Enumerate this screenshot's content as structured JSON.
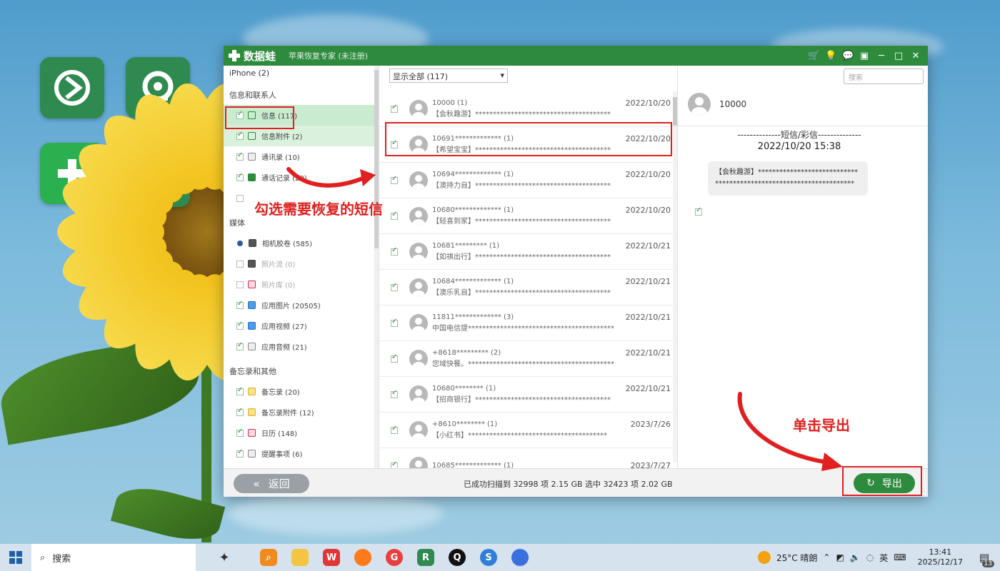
{
  "window": {
    "brand": "数据蛙",
    "subtitle": "苹果恢复专家 (未注册)",
    "controls": [
      "🛒",
      "💡",
      "💬",
      "▣",
      "─",
      "□",
      "✕"
    ]
  },
  "left_panel": {
    "device": "iPhone (2)",
    "sections": [
      {
        "title": "信息和联系人",
        "items": [
          {
            "label": "信息 (117)",
            "checked": true
          },
          {
            "label": "信息附件 (2)",
            "checked": true
          },
          {
            "label": "通讯录 (10)",
            "checked": true
          },
          {
            "label": "通话记录 (20)",
            "checked": true
          },
          {
            "label": "",
            "checked": false
          }
        ]
      },
      {
        "title": "媒体",
        "items": [
          {
            "label": "相机胶卷 (585)"
          },
          {
            "label": "照片流 (0)"
          },
          {
            "label": "照片库 (0)"
          },
          {
            "label": "应用图片 (20505)"
          },
          {
            "label": "应用视频 (27)"
          },
          {
            "label": "应用音频 (21)"
          }
        ]
      },
      {
        "title": "备忘录和其他",
        "items": [
          {
            "label": "备忘录 (20)"
          },
          {
            "label": "备忘录附件 (12)"
          },
          {
            "label": "日历 (148)"
          },
          {
            "label": "提醒事项 (6)"
          }
        ]
      }
    ]
  },
  "filter": {
    "value": "显示全部 (117)",
    "arrow": "▾"
  },
  "messages": [
    {
      "name": "10000 (1)",
      "date": "2022/10/20",
      "preview": "【会秋趣游】**************************************"
    },
    {
      "name": "10691************* (1)",
      "date": "2022/10/20",
      "preview": "【希望宝宝】**************************************"
    },
    {
      "name": "10694************* (1)",
      "date": "2022/10/20",
      "preview": "【澳持力自】**************************************"
    },
    {
      "name": "10680************* (1)",
      "date": "2022/10/20",
      "preview": "【轻喜到家】**************************************"
    },
    {
      "name": "10681********* (1)",
      "date": "2022/10/21",
      "preview": "【如祺出行】**************************************"
    },
    {
      "name": "10684************* (1)",
      "date": "2022/10/21",
      "preview": "【澳乐乳自】**************************************"
    },
    {
      "name": "11811************* (3)",
      "date": "2022/10/21",
      "preview": "中国电信提*****************************************"
    },
    {
      "name": "+8618********* (2)",
      "date": "2022/10/21",
      "preview": "您域快餐。*****************************************"
    },
    {
      "name": "10680******** (1)",
      "date": "2022/10/21",
      "preview": "【招商银行】**************************************"
    },
    {
      "name": "+8610******** (1)",
      "date": "2023/7/26",
      "preview": "【小红书】***************************************"
    },
    {
      "name": "10685************* (1)",
      "date": "2023/7/27",
      "preview": ""
    }
  ],
  "detail": {
    "search_placeholder": "搜索",
    "contact": "10000",
    "kind": "--------------短信/彩信--------------",
    "time": "2022/10/20 15:38",
    "body": "【会秋趣游】*******************************************************************"
  },
  "bottom": {
    "back_label": "返回",
    "status": "已成功扫描到 32998 项 2.15 GB  选中 32423 项 2.02 GB",
    "export_label": "导出"
  },
  "annotations": {
    "select_hint": "勾选需要恢复的短信",
    "export_hint": "单击导出",
    "color": "#e02020"
  },
  "taskbar": {
    "search": "搜索",
    "weather": "25°C 晴朗",
    "ime": "英",
    "time": "13:41",
    "date": "2025/12/17",
    "notifications": "13"
  },
  "colors": {
    "accent": "#2e8b3e",
    "selected_row": "#c9ebd0"
  }
}
